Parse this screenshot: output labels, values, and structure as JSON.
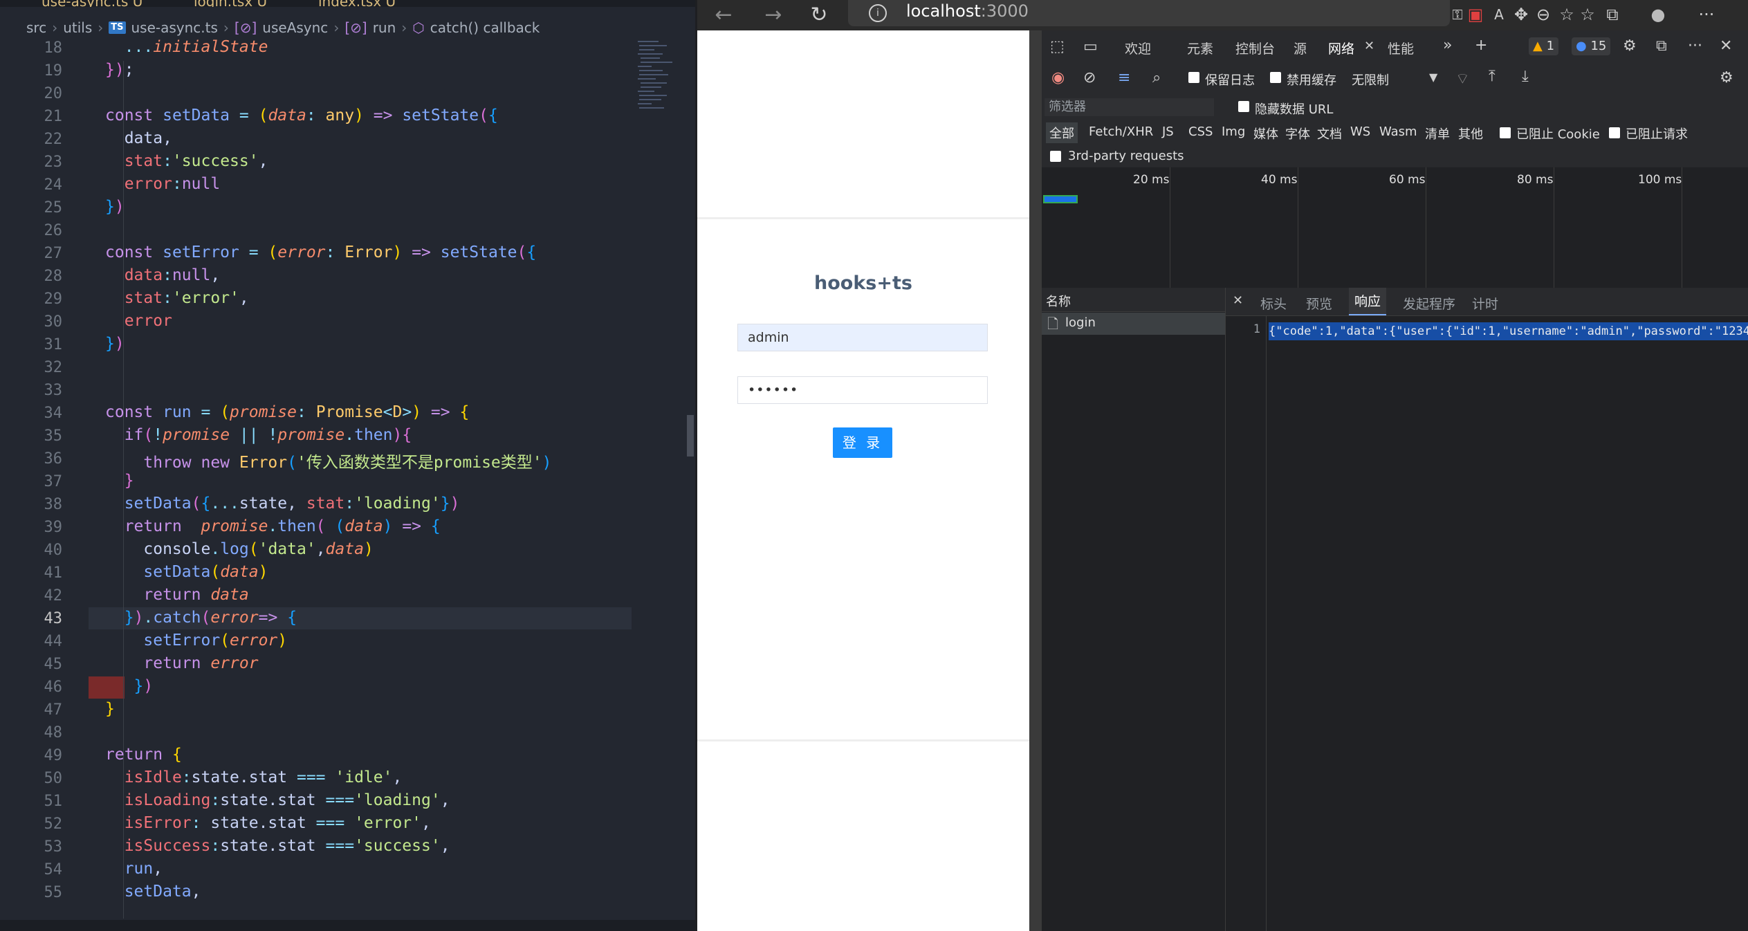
{
  "editor": {
    "tabs": [
      "use-async.ts U",
      "login.tsx U",
      "index.tsx U"
    ],
    "breadcrumb": [
      "src",
      "utils",
      "use-async.ts",
      "useAsync",
      "run",
      "catch() callback"
    ],
    "ts_badge": "TS",
    "line_numbers": [
      "18",
      "19",
      "20",
      "21",
      "22",
      "23",
      "24",
      "25",
      "26",
      "27",
      "28",
      "29",
      "30",
      "31",
      "32",
      "33",
      "34",
      "35",
      "36",
      "37",
      "38",
      "39",
      "40",
      "41",
      "42",
      "43",
      "44",
      "45",
      "46",
      "47",
      "48",
      "49",
      "50",
      "51",
      "52",
      "53",
      "54",
      "55"
    ],
    "active_line": "43"
  },
  "browser": {
    "address": "localhost",
    "address_port": ":3000",
    "page": {
      "title": "hooks+ts",
      "username_value": "admin",
      "password_value": "••••••",
      "login_button": "登 录"
    }
  },
  "devtools": {
    "tabs": [
      "欢迎",
      "元素",
      "控制台",
      "源",
      "网络",
      "性能"
    ],
    "active_tab": "网络",
    "warnings_count": "1",
    "messages_count": "15",
    "toolbar": {
      "preserve_log": "保留日志",
      "disable_cache": "禁用缓存",
      "throttle": "无限制"
    },
    "filter_placeholder": "筛选器",
    "hide_data_urls": "隐藏数据 URL",
    "resource_types": [
      "全部",
      "Fetch/XHR",
      "JS",
      "CSS",
      "Img",
      "媒体",
      "字体",
      "文档",
      "WS",
      "Wasm",
      "清单",
      "其他"
    ],
    "blocked_cookies": "已阻止 Cookie",
    "blocked_requests": "已阻止请求",
    "third_party": "3rd-party requests",
    "timeline_ticks": [
      "20 ms",
      "40 ms",
      "60 ms",
      "80 ms",
      "100 ms"
    ],
    "name_header": "名称",
    "requests": [
      "login"
    ],
    "detail_tabs": [
      "标头",
      "预览",
      "响应",
      "发起程序",
      "计时"
    ],
    "active_detail_tab": "响应",
    "response_line_no": "1",
    "response_text": "{\"code\":1,\"data\":{\"user\":{\"id\":1,\"username\":\"admin\",\"password\":\"1234"
  }
}
